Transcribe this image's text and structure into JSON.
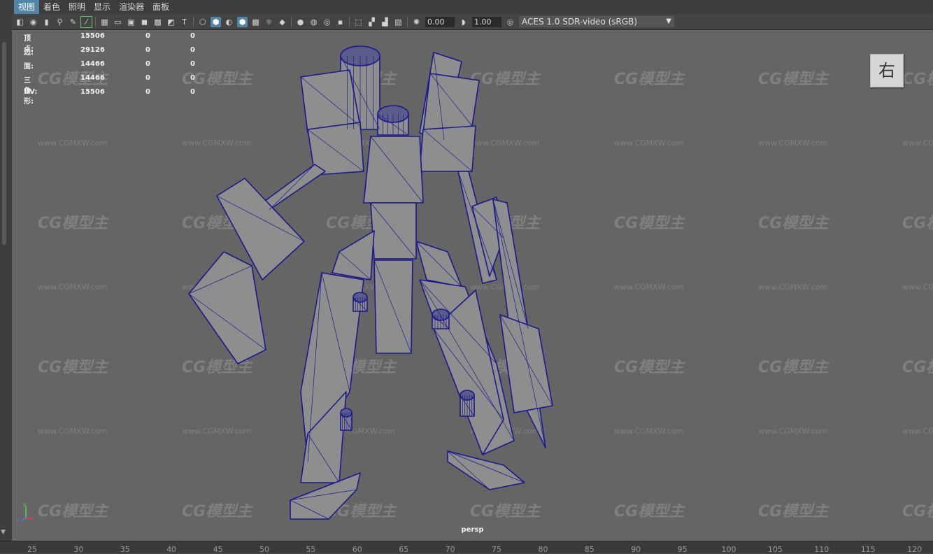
{
  "menu": [
    "视图",
    "着色",
    "照明",
    "显示",
    "渲染器",
    "面板"
  ],
  "toolbar": {
    "field_a": "0.00",
    "field_b": "1.00",
    "color_space": "ACES 1.0 SDR-video (sRGB)"
  },
  "hud": [
    {
      "label": "顶点:",
      "v1": "15506",
      "v2": "0",
      "v3": "0"
    },
    {
      "label": "边:",
      "v1": "29126",
      "v2": "0",
      "v3": "0"
    },
    {
      "label": "面:",
      "v1": "14466",
      "v2": "0",
      "v3": "0"
    },
    {
      "label": "三角形:",
      "v1": "14466",
      "v2": "0",
      "v3": "0"
    },
    {
      "label": "UV:",
      "v1": "15506",
      "v2": "0",
      "v3": "0"
    }
  ],
  "view_cube_label": "右",
  "camera_label": "persp",
  "watermark": {
    "logo": "CG模型主",
    "url": "www.CGMXW.com"
  },
  "ruler_ticks": [
    "25",
    "30",
    "35",
    "40",
    "45",
    "50",
    "55",
    "60",
    "65",
    "70",
    "75",
    "80",
    "85",
    "90",
    "95",
    "100",
    "105",
    "110",
    "115",
    "120"
  ],
  "colors": {
    "wire": "#1a1a8c",
    "mesh_fill": "#8e8e8e",
    "viewport_bg": "#656565"
  }
}
